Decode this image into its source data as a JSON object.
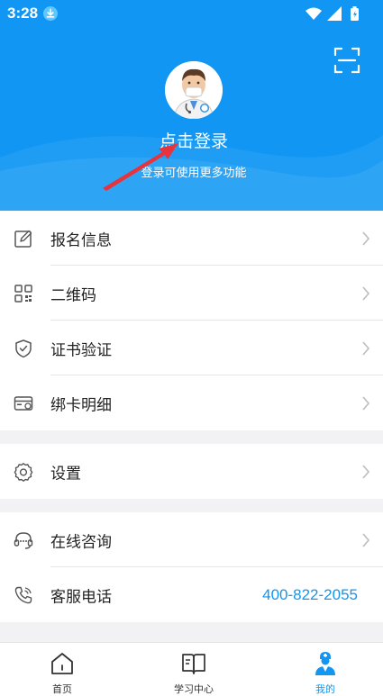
{
  "status_bar": {
    "time": "3:28"
  },
  "profile": {
    "login_title": "点击登录",
    "login_subtitle": "登录可使用更多功能"
  },
  "menu": {
    "group1": [
      {
        "label": "报名信息",
        "icon": "edit-icon"
      },
      {
        "label": "二维码",
        "icon": "qr-code-icon"
      },
      {
        "label": "证书验证",
        "icon": "shield-check-icon"
      },
      {
        "label": "绑卡明细",
        "icon": "card-icon"
      }
    ],
    "group2": [
      {
        "label": "设置",
        "icon": "gear-icon"
      }
    ],
    "group3": [
      {
        "label": "在线咨询",
        "icon": "headset-icon"
      },
      {
        "label": "客服电话",
        "icon": "phone-icon",
        "value": "400-822-2055"
      }
    ]
  },
  "tabbar": {
    "tabs": [
      {
        "label": "首页",
        "icon": "home-icon"
      },
      {
        "label": "学习中心",
        "icon": "book-icon"
      },
      {
        "label": "我的",
        "icon": "doctor-profile-icon",
        "active": true
      }
    ]
  },
  "colors": {
    "primary": "#1196f3",
    "annotation_arrow": "#e8323c"
  }
}
